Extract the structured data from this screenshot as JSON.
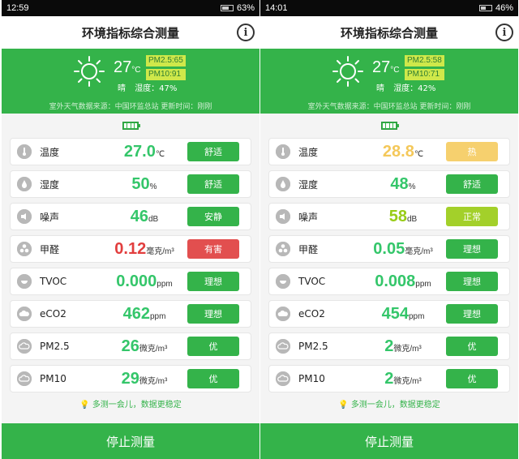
{
  "colors": {
    "green": "#34b34a",
    "yellow": "#f6d06e",
    "lime": "#a3d02a",
    "red": "#e24f4f",
    "value_green": "#34c66a",
    "value_yellow": "#f4c85a",
    "value_red": "#e23e3e",
    "value_lime": "#98cc16"
  },
  "screens": [
    {
      "time": "12:59",
      "battery_pct": "63%",
      "battery_level": 0.63,
      "title": "环境指标综合测量",
      "weather": {
        "temp": "27",
        "temp_unit": "°C",
        "pm25": "PM2.5:65",
        "pm10": "PM10:91",
        "condition": "晴",
        "humidity": "湿度：47%",
        "source": "室外天气数据来源：中国环监总站  更新时间：刚刚"
      },
      "rows": [
        {
          "icon": "thermometer-icon",
          "name": "温度",
          "value": "27.0",
          "unit": "℃",
          "status": "舒适",
          "status_color": "#34b34a",
          "value_color": "#34c66a"
        },
        {
          "icon": "humidity-drop-icon",
          "name": "湿度",
          "value": "50",
          "unit": "%",
          "status": "舒适",
          "status_color": "#34b34a",
          "value_color": "#34c66a"
        },
        {
          "icon": "noise-icon",
          "name": "噪声",
          "value": "46",
          "unit": "dB",
          "status": "安静",
          "status_color": "#34b34a",
          "value_color": "#34c66a"
        },
        {
          "icon": "fan-icon",
          "name": "甲醛",
          "value": "0.12",
          "unit": "毫克/m³",
          "status": "有害",
          "status_color": "#e24f4f",
          "value_color": "#e23e3e"
        },
        {
          "icon": "tvoc-icon",
          "name": "TVOC",
          "value": "0.000",
          "unit": "ppm",
          "status": "理想",
          "status_color": "#34b34a",
          "value_color": "#34c66a"
        },
        {
          "icon": "cloud-co2-icon",
          "name": "eCO2",
          "value": "462",
          "unit": "ppm",
          "status": "理想",
          "status_color": "#34b34a",
          "value_color": "#34c66a"
        },
        {
          "icon": "cloud-icon",
          "name": "PM2.5",
          "value": "26",
          "unit": "微克/m³",
          "status": "优",
          "status_color": "#34b34a",
          "value_color": "#34c66a"
        },
        {
          "icon": "cloud-icon",
          "name": "PM10",
          "value": "29",
          "unit": "微克/m³",
          "status": "优",
          "status_color": "#34b34a",
          "value_color": "#34c66a"
        }
      ],
      "tip": "多测一会儿，数据更稳定",
      "stop_label": "停止测量"
    },
    {
      "time": "14:01",
      "battery_pct": "46%",
      "battery_level": 0.46,
      "title": "环境指标综合测量",
      "weather": {
        "temp": "27",
        "temp_unit": "°C",
        "pm25": "PM2.5:58",
        "pm10": "PM10:71",
        "condition": "晴",
        "humidity": "湿度：42%",
        "source": "室外天气数据来源：中国环监总站  更新时间：刚刚"
      },
      "rows": [
        {
          "icon": "thermometer-icon",
          "name": "温度",
          "value": "28.8",
          "unit": "℃",
          "status": "热",
          "status_color": "#f6d06e",
          "value_color": "#f4c85a"
        },
        {
          "icon": "humidity-drop-icon",
          "name": "湿度",
          "value": "48",
          "unit": "%",
          "status": "舒适",
          "status_color": "#34b34a",
          "value_color": "#34c66a"
        },
        {
          "icon": "noise-icon",
          "name": "噪声",
          "value": "58",
          "unit": "dB",
          "status": "正常",
          "status_color": "#a3d02a",
          "value_color": "#98cc16"
        },
        {
          "icon": "fan-icon",
          "name": "甲醛",
          "value": "0.05",
          "unit": "毫克/m³",
          "status": "理想",
          "status_color": "#34b34a",
          "value_color": "#34c66a"
        },
        {
          "icon": "tvoc-icon",
          "name": "TVOC",
          "value": "0.008",
          "unit": "ppm",
          "status": "理想",
          "status_color": "#34b34a",
          "value_color": "#34c66a"
        },
        {
          "icon": "cloud-co2-icon",
          "name": "eCO2",
          "value": "454",
          "unit": "ppm",
          "status": "理想",
          "status_color": "#34b34a",
          "value_color": "#34c66a"
        },
        {
          "icon": "cloud-icon",
          "name": "PM2.5",
          "value": "2",
          "unit": "微克/m³",
          "status": "优",
          "status_color": "#34b34a",
          "value_color": "#34c66a"
        },
        {
          "icon": "cloud-icon",
          "name": "PM10",
          "value": "2",
          "unit": "微克/m³",
          "status": "优",
          "status_color": "#34b34a",
          "value_color": "#34c66a"
        }
      ],
      "tip": "多测一会儿，数据更稳定",
      "stop_label": "停止测量"
    }
  ]
}
